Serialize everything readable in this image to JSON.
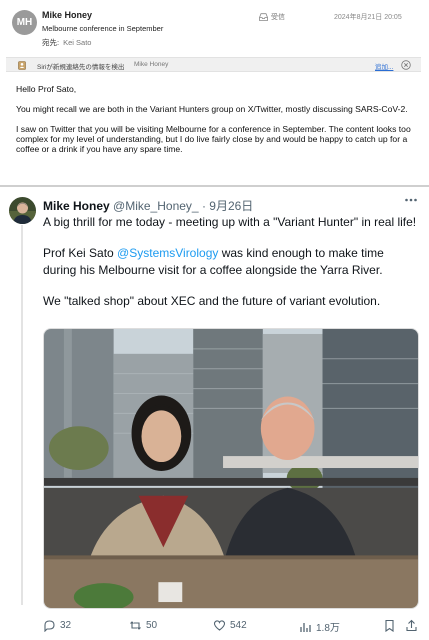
{
  "email": {
    "avatar_initials": "MH",
    "sender": "Mike Honey",
    "subject": "Melbourne conference in September",
    "to_label": "宛先:",
    "to_value": "Kei Sato",
    "folder": "受信",
    "date": "2024年8月21日 20:05",
    "siri": {
      "text": "Siriが新規連絡先の情報を検出",
      "name": "Mike Honey",
      "add_label": "追加..."
    },
    "body": [
      "Hello Prof Sato,",
      "You might recall we are both in the Variant Hunters group on X/Twitter, mostly discussing SARS-CoV-2.",
      "I saw on Twitter that you will be visiting Melbourne for a conference in September. The content looks too complex for my level of understanding, but I do live fairly close by and would be happy to catch up for a coffee or a drink if you have any spare time."
    ]
  },
  "tweet": {
    "name": "Mike Honey",
    "handle": "@Mike_Honey_",
    "separator": "·",
    "date": "9月26日",
    "line1": "A big thrill for me today - meeting up with a \"Variant Hunter\" in real life!",
    "line2_pre": "Prof Kei Sato ",
    "line2_mention": "@SystemsVirology",
    "line2_post": " was kind enough to make time during his Melbourne visit for a coffee alongside the Yarra River.",
    "line3": "We \"talked shop\" about XEC and the future of variant evolution.",
    "stats": {
      "replies": "32",
      "retweets": "50",
      "likes": "542",
      "views": "1.8万"
    }
  },
  "icons": {
    "inbox": "inbox-icon",
    "siri": "contact-card-icon",
    "close": "close-circle-icon",
    "more": "more-icon",
    "reply": "reply-icon",
    "retweet": "retweet-icon",
    "like": "heart-icon",
    "views": "views-icon",
    "bookmark": "bookmark-icon",
    "share": "share-icon"
  },
  "colors": {
    "link_blue": "#1d9bf0",
    "text_dark": "#0f1419",
    "text_muted": "#536471",
    "mail_link": "#2a6dd3"
  }
}
